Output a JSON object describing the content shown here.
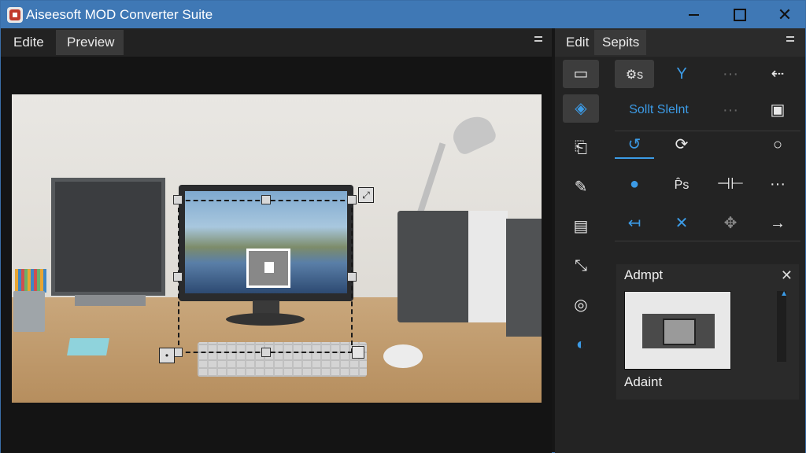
{
  "window": {
    "title": "Aiseesoft MOD Converter Suite"
  },
  "left_pane": {
    "tabs": [
      {
        "label": "Edite"
      },
      {
        "label": "Preview"
      }
    ]
  },
  "right_pane": {
    "tabs": [
      {
        "label": "Edit"
      },
      {
        "label": "Sepits"
      }
    ],
    "tool_grid": {
      "settings_label": "⚙s",
      "split_label": "Sollt Slelnt",
      "fp_label": "P̂s"
    },
    "adjust_panel": {
      "title": "Admpt",
      "label": "Adaint"
    }
  },
  "colors": {
    "titlebar": "#3f78b5",
    "accent": "#3c9be6"
  },
  "icons": [
    "screen-icon",
    "layers-icon",
    "crop-icon",
    "pen-icon",
    "stack-icon",
    "resize-icon",
    "target-icon",
    "brush-icon",
    "settings-icon",
    "merge-icon",
    "more-icon",
    "back-arrow-icon",
    "image-icon",
    "rotate-left-icon",
    "rotate-both-icon",
    "circle-icon",
    "clock-icon",
    "split-h-icon",
    "undo-icon",
    "close-x-icon",
    "move-icon",
    "forward-arrow-icon"
  ]
}
